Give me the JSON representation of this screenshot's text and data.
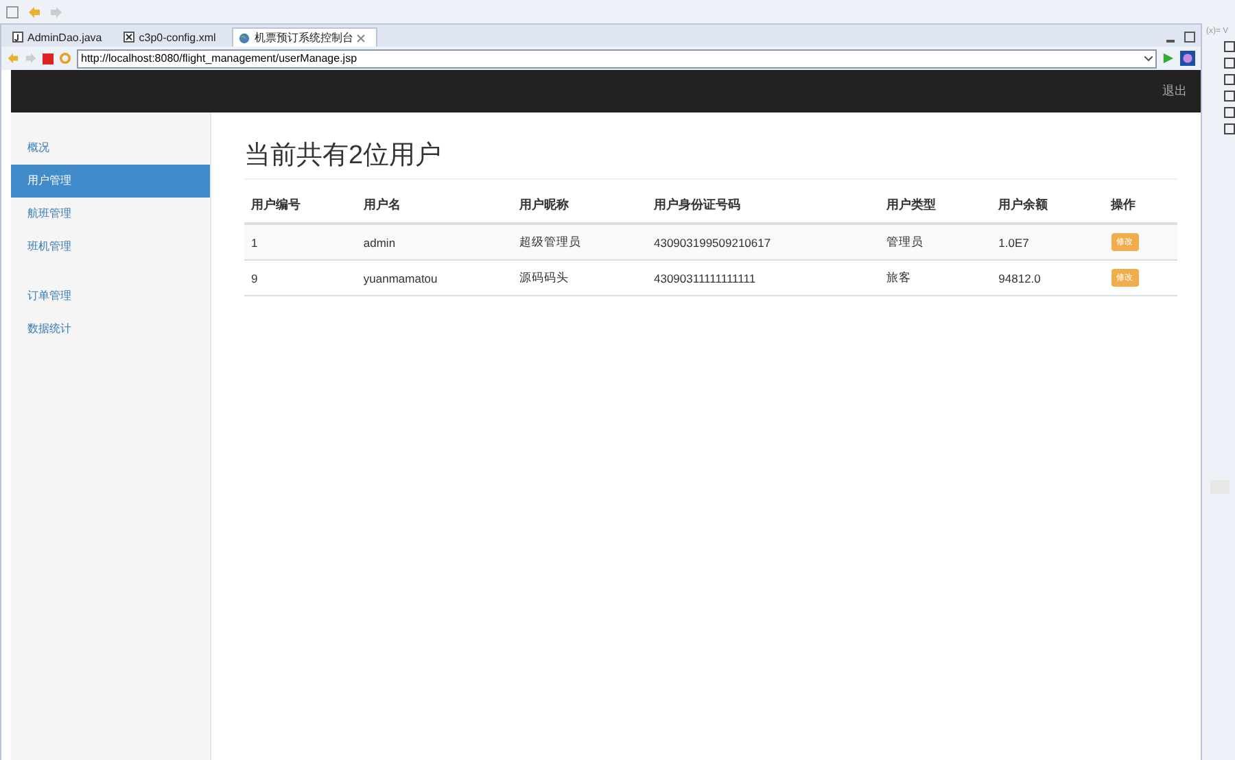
{
  "tabs": [
    {
      "label": "AdminDao.java",
      "kind": "java",
      "selected": false
    },
    {
      "label": "c3p0-config.xml",
      "kind": "xml",
      "selected": false
    },
    {
      "label": "机票预订系统控制台",
      "kind": "web",
      "selected": true
    }
  ],
  "address": {
    "value": "http://localhost:8080/flight_management/userManage.jsp"
  },
  "navbar": {
    "logout": "退出"
  },
  "sidebar": {
    "sections": [
      [
        {
          "label": "概况",
          "selected": false
        },
        {
          "label": "用户管理",
          "selected": true
        },
        {
          "label": "航班管理",
          "selected": false
        },
        {
          "label": "班机管理",
          "selected": false
        }
      ],
      [
        {
          "label": "订单管理",
          "selected": false
        },
        {
          "label": "数据统计",
          "selected": false
        }
      ]
    ]
  },
  "heading": "当前共有2位用户",
  "table": {
    "columns": [
      "用户编号",
      "用户名",
      "用户昵称",
      "用户身份证号码",
      "用户类型",
      "用户余额",
      "操作"
    ],
    "rows": [
      {
        "cells": [
          "1",
          "admin",
          "超级管理员",
          "430903199509210617",
          "管理员",
          "1.0E7"
        ],
        "action": "修改"
      },
      {
        "cells": [
          "9",
          "yuanmamatou",
          "源码码头",
          "43090311111111111",
          "旅客",
          "94812.0"
        ],
        "action": "修改"
      }
    ]
  },
  "side_panel": {
    "title": "(x)= V"
  }
}
